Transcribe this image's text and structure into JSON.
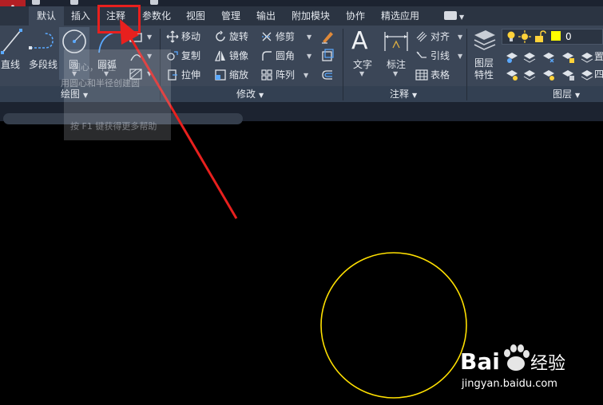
{
  "app": {
    "logo_letter": "A",
    "brand_color": "#b31f24",
    "accent_highlight": "#e8201e"
  },
  "tabs": [
    {
      "label": "默认",
      "active": true
    },
    {
      "label": "插入"
    },
    {
      "label": "注释",
      "highlighted": true
    },
    {
      "label": "参数化"
    },
    {
      "label": "视图"
    },
    {
      "label": "管理"
    },
    {
      "label": "输出"
    },
    {
      "label": "附加模块"
    },
    {
      "label": "协作"
    },
    {
      "label": "精选应用"
    }
  ],
  "draw_panel": {
    "title": "绘图",
    "line": "直线",
    "polyline": "多段线",
    "circle": "圆",
    "arc": "圆弧"
  },
  "modify_panel": {
    "title": "修改",
    "move": "移动",
    "rotate": "旋转",
    "trim": "修剪",
    "copy": "复制",
    "mirror": "镜像",
    "fillet": "圆角",
    "stretch": "拉伸",
    "scale": "缩放",
    "array": "阵列"
  },
  "annotation_panel": {
    "title": "注释",
    "text": "文字",
    "dimension": "标注",
    "align": "对齐",
    "leader": "引线",
    "table": "表格"
  },
  "layers_panel": {
    "title": "图层",
    "layer_properties": "图层\n特性",
    "current_layer": "0",
    "current_layer_color": "#ffff00",
    "row2_clip": "置",
    "row3_clip": "四"
  },
  "tooltip": {
    "title": "圆心，半径",
    "description": "用圆心和半径创建圆",
    "help": "按 F1 键获得更多帮助"
  },
  "drawing": {
    "circle_color": "#ffe000"
  },
  "watermark": {
    "brand": "Bai",
    "brand_tail": "经验",
    "url": "jingyan.baidu.com"
  }
}
